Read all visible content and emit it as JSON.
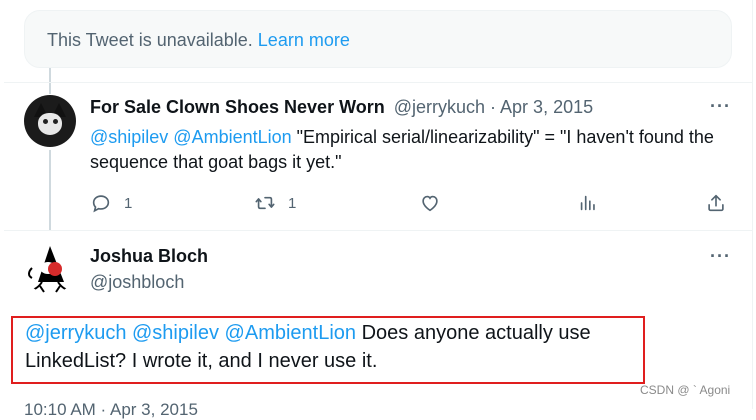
{
  "unavailable": {
    "text": "This Tweet is unavailable.",
    "link": "Learn more"
  },
  "tweet1": {
    "name": "For Sale Clown Shoes Never Worn",
    "meta": "@jerrykuch · Apr 3, 2015",
    "more": "···",
    "mentions": "@shipilev @AmbientLion",
    "text": " \"Empirical serial/linearizability\" = \"I haven't found the sequence that goat bags it yet.\"",
    "actions": {
      "reply_count": "1",
      "retweet_count": "1"
    },
    "icons": [
      "reply-icon",
      "retweet-icon",
      "like-icon",
      "views-icon",
      "share-icon"
    ]
  },
  "tweet2": {
    "name": "Joshua Bloch",
    "handle": "@joshbloch",
    "more": "···",
    "mentions": "@jerrykuch @shipilev @AmbientLion",
    "text": " Does anyone actually use LinkedList?  I wrote it, and I never use it.",
    "time": "10:10 AM · Apr 3, 2015"
  },
  "watermark": "CSDN @ ` Agoni",
  "colors": {
    "accent": "#1d9bf0",
    "muted": "#536471",
    "highlight": "#e01e1e"
  }
}
